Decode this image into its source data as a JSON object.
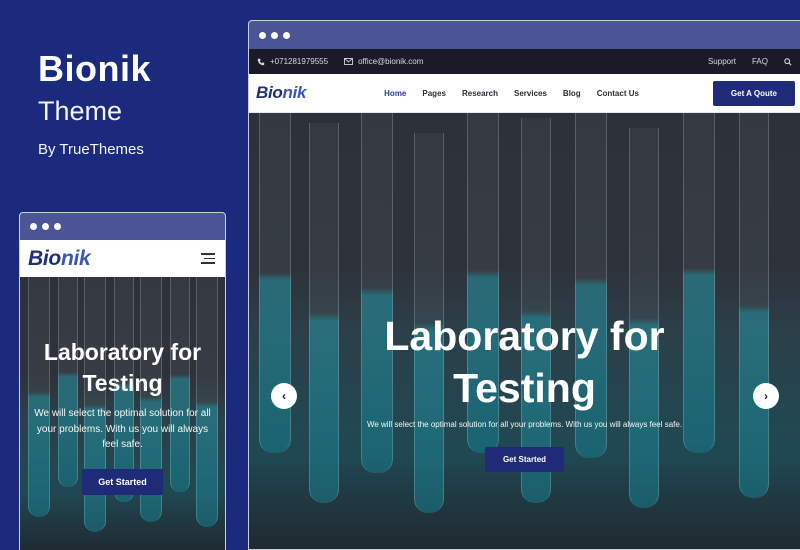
{
  "promo": {
    "brand": "Bionik",
    "subtitle": "Theme",
    "byline": "By TrueThemes"
  },
  "brand_logo": {
    "main": "Bio",
    "accent": "nik"
  },
  "mobile": {
    "hero": {
      "title_line1": "Laboratory for",
      "title_line2": "Testing",
      "subtitle": "We will select the optimal solution for all your problems. With us you will always feel safe.",
      "button": "Get Started"
    }
  },
  "desktop": {
    "topbar": {
      "phone": "+071281979555",
      "email": "office@bionik.com",
      "support": "Support",
      "faq": "FAQ"
    },
    "nav": {
      "items": [
        "Home",
        "Pages",
        "Research",
        "Services",
        "Blog",
        "Contact Us"
      ],
      "active": "Home",
      "cta": "Get A Qoute"
    },
    "hero": {
      "title_line1": "Laboratory for",
      "title_line2": "Testing",
      "subtitle": "We will select the optimal solution for all your problems. With us you will always feel safe.",
      "button": "Get Started"
    }
  },
  "colors": {
    "page_background": "#1c2a7e",
    "window_bar": "#4b5596",
    "primary_button": "#1f2a78",
    "topbar": "#191c26"
  },
  "icons": [
    "phone-icon",
    "mail-icon",
    "search-icon",
    "hamburger-icon",
    "chevron-left-icon",
    "chevron-right-icon"
  ]
}
